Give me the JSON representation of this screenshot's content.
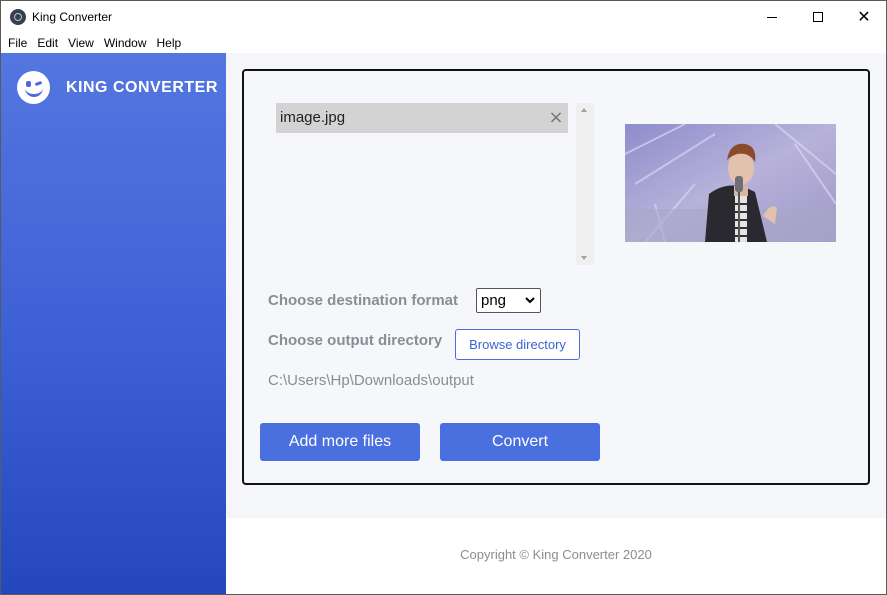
{
  "window": {
    "title": "King Converter"
  },
  "menu": [
    "File",
    "Edit",
    "View",
    "Window",
    "Help"
  ],
  "sidebar": {
    "brand": "KING CONVERTER",
    "logo_icon": "winking-smiley-icon"
  },
  "file_list": {
    "items": [
      {
        "name": "image.jpg"
      }
    ]
  },
  "form": {
    "format_label": "Choose destination format",
    "format_selected": "png",
    "output_label": "Choose output directory",
    "browse_label": "Browse directory",
    "output_path": "C:\\Users\\Hp\\Downloads\\output"
  },
  "actions": {
    "add_label": "Add more files",
    "convert_label": "Convert"
  },
  "footer": {
    "copyright": "Copyright © King Converter 2020"
  },
  "colors": {
    "accent": "#4a6fdf",
    "sidebar_top": "#5476e0",
    "sidebar_bottom": "#2547bd",
    "muted_text": "#8a8d94"
  }
}
